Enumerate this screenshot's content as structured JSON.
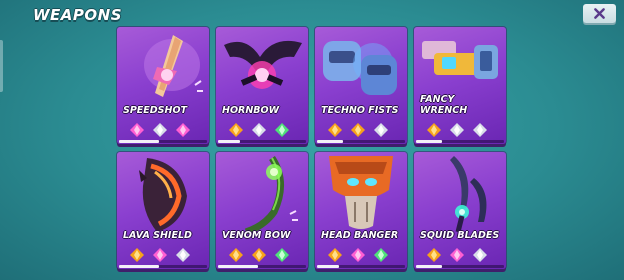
{
  "header": {
    "title": "WEAPONS",
    "close_icon": "close-x-icon"
  },
  "colors": {
    "background": "#2b8c92",
    "card_purple": "#8a3fcf",
    "gem_orange": "#f7a21b",
    "gem_silver": "#d8dde8",
    "gem_pink": "#ff5fd2",
    "gem_green": "#4fe07a"
  },
  "weapons": [
    {
      "name": "SPEEDSHOT",
      "gems": [
        "pink",
        "silver",
        "pink"
      ],
      "progress": 0.45
    },
    {
      "name": "HORNBOW",
      "gems": [
        "orange",
        "silver",
        "green"
      ],
      "progress": 0.25
    },
    {
      "name": "TECHNO FISTS",
      "gems": [
        "orange",
        "orange",
        "silver"
      ],
      "progress": 0.3
    },
    {
      "name": "FANCY WRENCH",
      "gems": [
        "orange",
        "silver",
        "silver"
      ],
      "progress": 0.3
    },
    {
      "name": "LAVA SHIELD",
      "gems": [
        "orange",
        "pink",
        "silver"
      ],
      "progress": 0.45
    },
    {
      "name": "VENOM BOW",
      "gems": [
        "orange",
        "orange",
        "green"
      ],
      "progress": 0.45
    },
    {
      "name": "HEAD BANGER",
      "gems": [
        "orange",
        "pink",
        "green"
      ],
      "progress": 0.25
    },
    {
      "name": "SQUID BLADES",
      "gems": [
        "orange",
        "pink",
        "silver"
      ],
      "progress": 0.3
    }
  ]
}
